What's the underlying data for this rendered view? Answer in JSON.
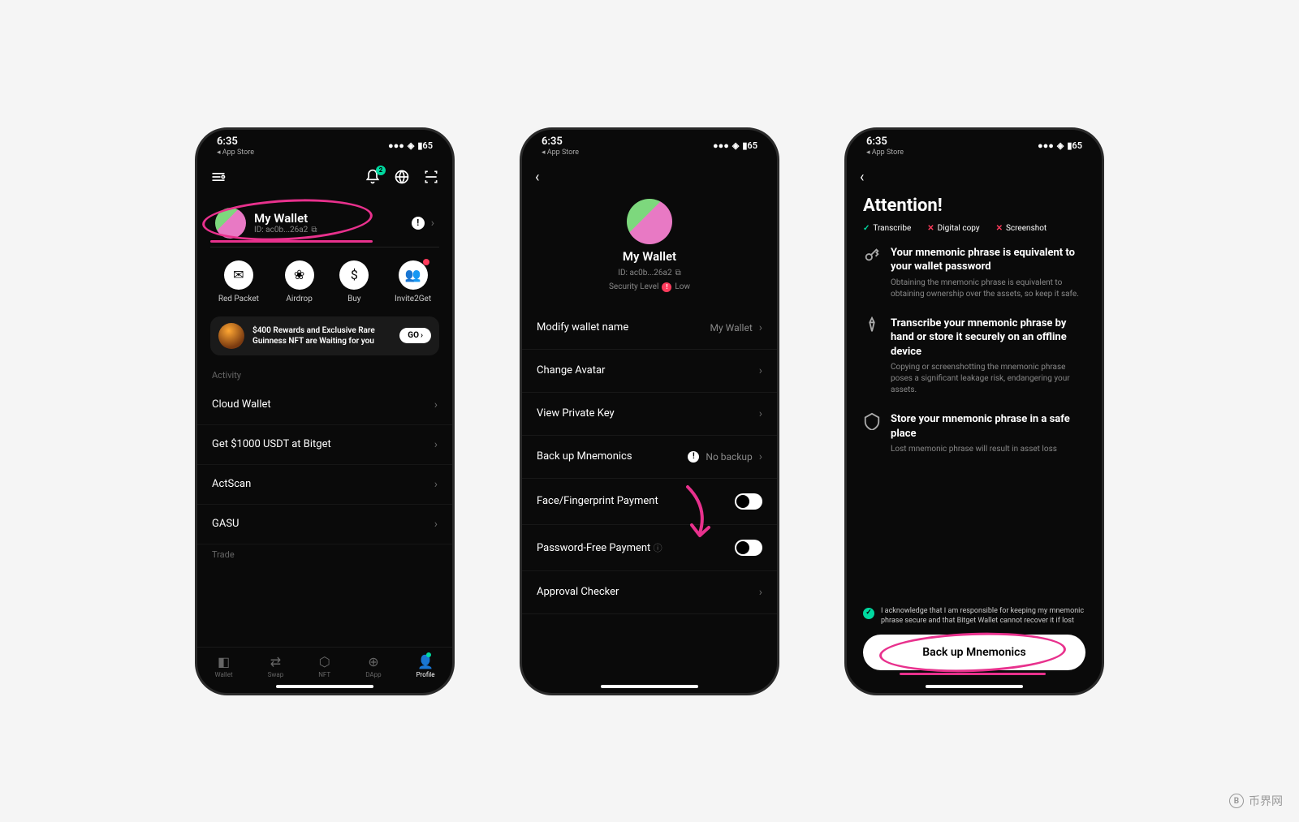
{
  "status": {
    "time": "6:35",
    "appstore": "◂ App Store",
    "battery": "65"
  },
  "phone1": {
    "notif_badge": "2",
    "wallet": {
      "name": "My Wallet",
      "id": "ID: ac0b...26a2"
    },
    "actions": [
      {
        "label": "Red Packet",
        "icon": "✉"
      },
      {
        "label": "Airdrop",
        "icon": "❀"
      },
      {
        "label": "Buy",
        "icon": "$"
      },
      {
        "label": "Invite2Get",
        "icon": "👥"
      }
    ],
    "banner": {
      "text": "$400 Rewards and Exclusive Rare Guinness NFT are Waiting for you",
      "btn": "GO"
    },
    "sections": {
      "activity_label": "Activity",
      "rows": [
        "Cloud Wallet",
        "Get $1000 USDT at Bitget",
        "ActScan",
        "GASU"
      ],
      "trade_label": "Trade"
    },
    "tabs": [
      {
        "label": "Wallet",
        "icon": "◧"
      },
      {
        "label": "Swap",
        "icon": "⇄"
      },
      {
        "label": "NFT",
        "icon": "⬡"
      },
      {
        "label": "DApp",
        "icon": "⊕"
      },
      {
        "label": "Profile",
        "icon": "👤"
      }
    ]
  },
  "phone2": {
    "wallet": {
      "name": "My Wallet",
      "id": "ID: ac0b...26a2",
      "sec_label": "Security Level",
      "sec_value": "Low"
    },
    "rows": {
      "modify": {
        "label": "Modify wallet name",
        "value": "My Wallet"
      },
      "avatar": {
        "label": "Change Avatar"
      },
      "privkey": {
        "label": "View Private Key"
      },
      "backup": {
        "label": "Back up Mnemonics",
        "value": "No backup"
      },
      "face": {
        "label": "Face/Fingerprint Payment"
      },
      "pwdfree": {
        "label": "Password-Free Payment"
      },
      "approval": {
        "label": "Approval Checker"
      }
    }
  },
  "phone3": {
    "title": "Attention!",
    "checks": [
      {
        "ok": true,
        "label": "Transcribe"
      },
      {
        "ok": false,
        "label": "Digital copy"
      },
      {
        "ok": false,
        "label": "Screenshot"
      }
    ],
    "blocks": [
      {
        "title": "Your mnemonic phrase is equivalent to your wallet password",
        "desc": "Obtaining the mnemonic phrase is equivalent to obtaining ownership over the assets, so keep it safe."
      },
      {
        "title": "Transcribe your mnemonic phrase by hand or store it securely on an offline device",
        "desc": "Copying or screenshotting the mnemonic phrase poses a significant leakage risk, endangering your assets."
      },
      {
        "title": "Store your mnemonic phrase in a safe place",
        "desc": "Lost mnemonic phrase will result in asset loss"
      }
    ],
    "ack": "I acknowledge that I am responsible for keeping my mnemonic phrase secure and that Bitget Wallet cannot recover it if lost",
    "button": "Back up Mnemonics"
  },
  "watermark": "币界网"
}
